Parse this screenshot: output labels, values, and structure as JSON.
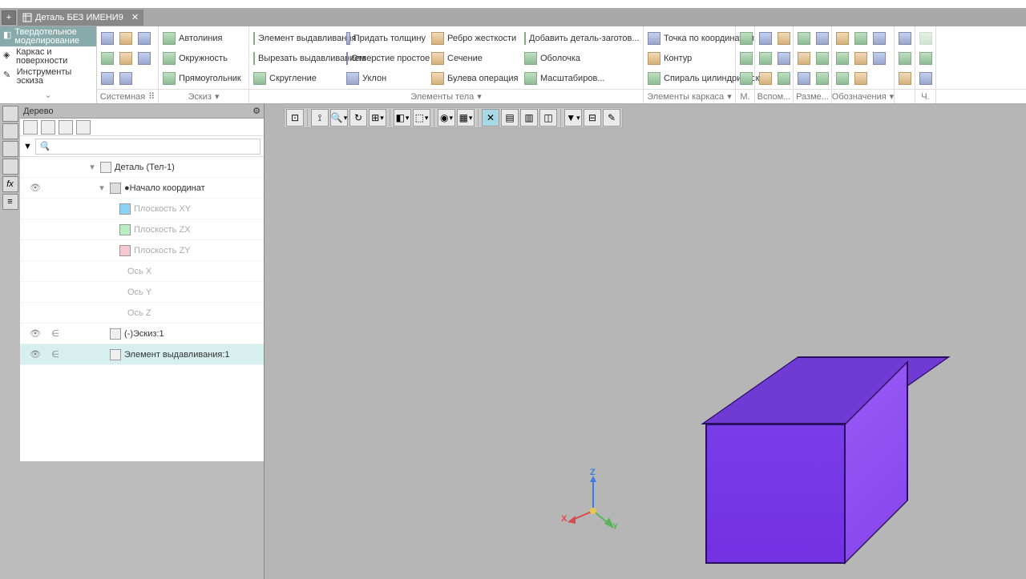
{
  "tab": {
    "title": "Деталь БЕЗ ИМЕНИ9"
  },
  "modes": [
    {
      "label": "Твердотельное моделирование"
    },
    {
      "label": "Каркас и поверхности"
    },
    {
      "label": "Инструменты эскиза"
    }
  ],
  "system_group": {
    "label": "Системная"
  },
  "sketch_group": {
    "label": "Эскиз",
    "items": {
      "autoline": "Автолиния",
      "circle": "Окружность",
      "rect": "Прямоугольник"
    }
  },
  "body_group": {
    "label": "Элементы тела",
    "items": {
      "extrude": "Элемент выдавливания",
      "cut": "Вырезать выдавливанием",
      "fillet": "Скругление",
      "thickness": "Придать толщину",
      "hole": "Отверстие простое",
      "draft": "Уклон",
      "rib": "Ребро жесткости",
      "section": "Сечение",
      "bool": "Булева операция",
      "add": "Добавить деталь-заготов...",
      "shell": "Оболочка",
      "scale": "Масштабиров..."
    }
  },
  "frame_group": {
    "label": "Элементы каркаса",
    "items": {
      "point": "Точка по координатам",
      "contour": "Контур",
      "spiral": "Спираль цилиндрическ..."
    }
  },
  "more_groups": {
    "m": "М.",
    "vsp": "Вспом...",
    "size": "Разме...",
    "notation": "Обозначения",
    "ch": "Ч."
  },
  "panel": {
    "title": "Дерево",
    "search_placeholder": "🔍"
  },
  "tree": {
    "root": "Деталь (Тел-1)",
    "origin": "Начало координат",
    "planes": {
      "xy": "Плоскость XY",
      "zx": "Плоскость ZX",
      "zy": "Плоскость ZY"
    },
    "axes": {
      "x": "Ось X",
      "y": "Ось Y",
      "z": "Ось Z"
    },
    "sketch": "(-)Эскиз:1",
    "extr": "Элемент выдавливания:1"
  },
  "axes3d": {
    "x": "X",
    "y": "Y",
    "z": "Z"
  }
}
